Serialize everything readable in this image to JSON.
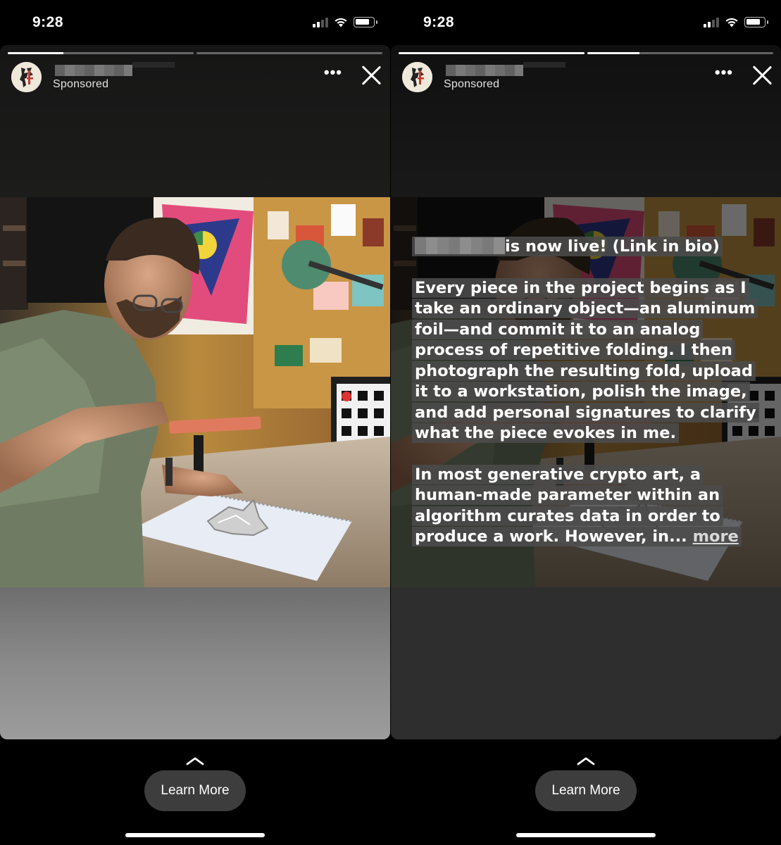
{
  "screens": [
    {
      "status_bar": {
        "time": "9:28"
      },
      "story": {
        "progress": [
          0.3,
          0.0
        ],
        "sponsored_label": "Sponsored",
        "more_menu": "•••"
      },
      "cta": {
        "chevron": "chevron-up-icon",
        "label": "Learn More"
      }
    },
    {
      "status_bar": {
        "time": "9:28"
      },
      "story": {
        "progress": [
          1.0,
          0.28
        ],
        "sponsored_label": "Sponsored",
        "more_menu": "•••",
        "caption": {
          "line1": "is now live! (Link in bio)",
          "paragraph2": "Every piece in the project begins as I take an ordinary object—an aluminum foil—and commit it to an analog process of repetitive folding. I then photograph the resulting fold, upload it to a workstation, polish the image, and add personal signatures to clarify what the piece evokes in me.",
          "paragraph3": "In most generative crypto art, a human-made parameter within an algorithm curates data in order to produce a work. However, in...",
          "more_link": "more"
        }
      },
      "cta": {
        "chevron": "chevron-up-icon",
        "label": "Learn More"
      }
    }
  ],
  "colors": {
    "background": "#000000",
    "cta_bg": "#3d3d3d",
    "caption_highlight": "#4b4b4b"
  }
}
